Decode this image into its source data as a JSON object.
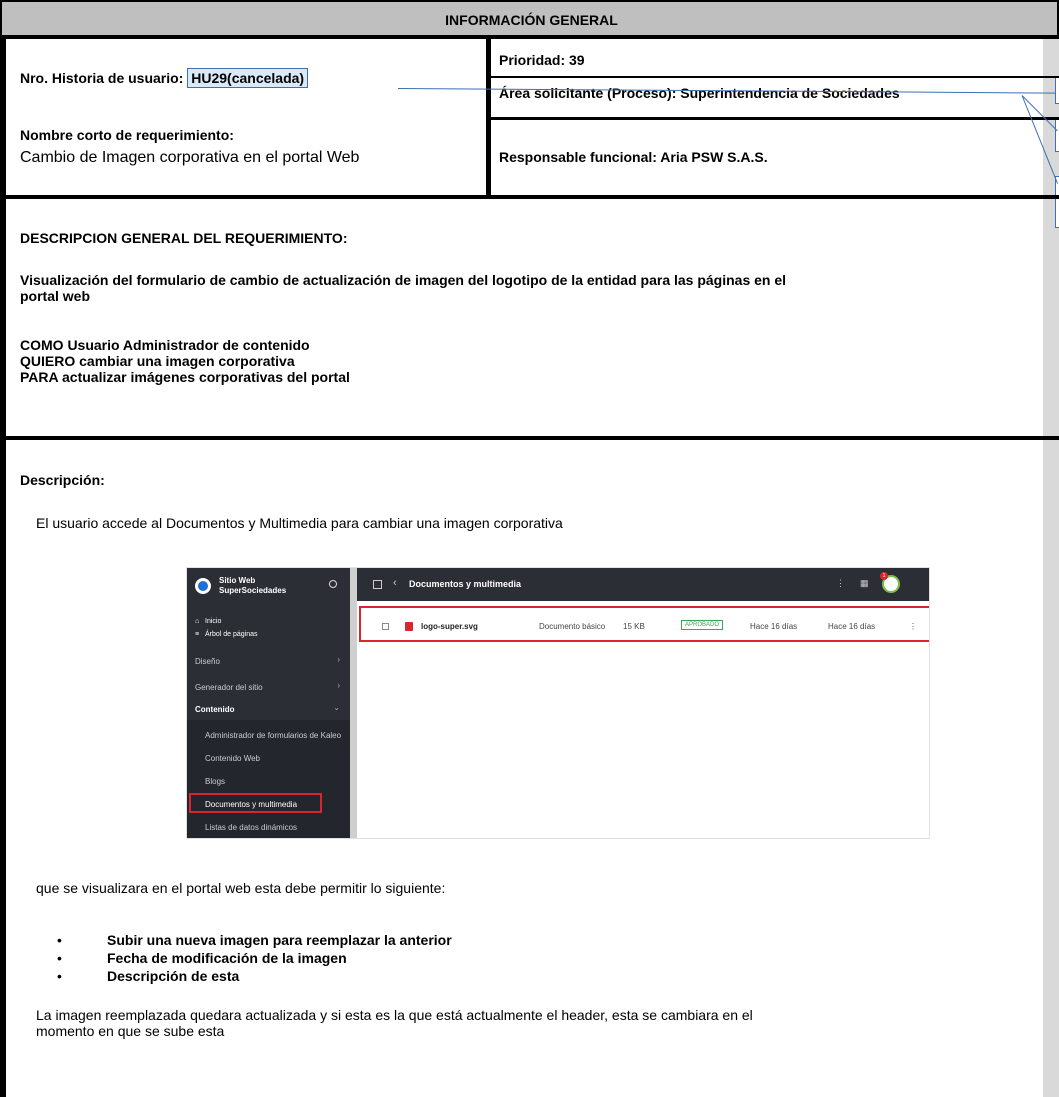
{
  "header": {
    "title": "INFORMACIÓN GENERAL"
  },
  "info": {
    "historia_label": "Nro. Historia de usuario:",
    "historia_value": "HU29(cancelada)",
    "prioridad": "Prioridad:  39",
    "area": "Área solicitante (Proceso): Superintendencia de Sociedades",
    "nombre_label": "Nombre corto de requerimiento:",
    "nombre_value": "Cambio de Imagen corporativa en el portal Web",
    "responsable": "Responsable funcional: Aria PSW S.A.S."
  },
  "descripcion_general": {
    "title": "DESCRIPCION GENERAL DEL REQUERIMIENTO:",
    "line1": "Visualización del formulario de cambio de actualización de imagen del logotipo de la entidad para las páginas en el",
    "line2": "portal web",
    "como": "COMO Usuario Administrador de contenido",
    "quiero": "QUIERO cambiar una imagen corporativa",
    "para": "PARA actualizar  imágenes corporativas del portal"
  },
  "descripcion": {
    "title": "Descripción:",
    "intro": "El usuario accede al Documentos y Multimedia  para cambiar una imagen corporativa",
    "after_image": "que se visualizara en el portal web esta debe permitir lo siguiente:",
    "bullets": [
      "Subir una nueva imagen para reemplazar la anterior",
      "Fecha de modificación de la imagen",
      "Descripción de esta"
    ],
    "closing1": "La imagen reemplazada quedara actualizada y si esta es la que está actualmente el header, esta se cambiara en el",
    "closing2": "momento en que se sube esta"
  },
  "screenshot": {
    "site_name": "Sitio Web",
    "site_sub": "SuperSociedades",
    "nav": {
      "inicio": "Inicio",
      "arbol": "Árbol de páginas",
      "diseno": "Diseño",
      "generador": "Generador del sitio",
      "contenido": "Contenido",
      "admin_forms": "Administrador de formularios de Kaleo",
      "contenido_web": "Contenido Web",
      "blogs": "Blogs",
      "documentos": "Documentos y multimedia",
      "listas": "Listas de datos dinámicos"
    },
    "topbar_title": "Documentos y multimedia",
    "notification_count": "1",
    "file": {
      "name": "logo-super.svg",
      "type": "Documento básico",
      "size": "15 KB",
      "status": "APROBADO",
      "created": "Hace 16 días",
      "modified": "Hace 16 días"
    },
    "colors": {
      "sidebar": "#2b2e35",
      "highlight": "#d9262e",
      "approved": "#3aa65a"
    }
  }
}
